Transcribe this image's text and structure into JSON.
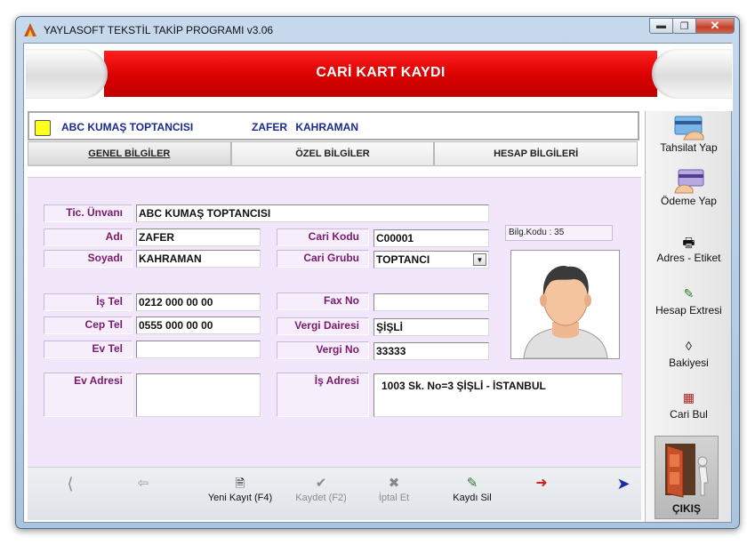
{
  "window": {
    "title": "YAYLASOFT TEKSTİL TAKİP PROGRAMI v3.06",
    "minimize_icon": "minimize-icon",
    "restore_icon": "restore-icon",
    "close_icon": "close-icon"
  },
  "banner": {
    "title": "CARİ KART KAYDI"
  },
  "info": {
    "company": "ABC KUMAŞ TOPTANCISI",
    "person": "ZAFER KAHRAMAN",
    "status_color": "#ffff20"
  },
  "tabs": [
    {
      "label": "GENEL BİLGİLER",
      "active": true
    },
    {
      "label": "ÖZEL BİLGİLER",
      "active": false
    },
    {
      "label": "HESAP BİLGİLERİ",
      "active": false
    }
  ],
  "form": {
    "tic_unvani": {
      "label": "Tic. Ünvanı",
      "value": "ABC KUMAŞ TOPTANCISI"
    },
    "adi": {
      "label": "Adı",
      "value": "ZAFER"
    },
    "soyadi": {
      "label": "Soyadı",
      "value": "KAHRAMAN"
    },
    "cari_kodu": {
      "label": "Cari Kodu",
      "value": "C00001"
    },
    "cari_grubu": {
      "label": "Cari Grubu",
      "value": "TOPTANCI"
    },
    "is_tel": {
      "label": "İş Tel",
      "value": "0212 000 00 00"
    },
    "cep_tel": {
      "label": "Cep Tel",
      "value": "0555 000 00 00"
    },
    "ev_tel": {
      "label": "Ev Tel",
      "value": ""
    },
    "fax_no": {
      "label": "Fax No",
      "value": ""
    },
    "vergi_dairesi": {
      "label": "Vergi Dairesi",
      "value": "ŞİŞLİ"
    },
    "vergi_no": {
      "label": "Vergi No",
      "value": "33333"
    },
    "ev_adresi": {
      "label": "Ev Adresi",
      "value": ""
    },
    "is_adresi": {
      "label": "İş Adresi",
      "value": "1003 Sk. No=3 ŞİŞLİ - İSTANBUL"
    },
    "bilg_kodu": "Bilg.Kodu : 35"
  },
  "bottom": {
    "first_icon": "first-record-icon",
    "prev_icon": "previous-record-icon",
    "new_label": "Yeni Kayıt (F4)",
    "save_label": "Kaydet (F2)",
    "cancel_label": "İptal Et",
    "delete_label": "Kaydı Sil",
    "next_icon": "next-record-icon",
    "last_icon": "last-record-icon"
  },
  "sidebar": {
    "tahsilat": "Tahsilat Yap",
    "odeme": "Ödeme Yap",
    "adres": "Adres - Etiket",
    "extre": "Hesap Extresi",
    "bakiye": "Bakiyesi",
    "bul": "Cari Bul",
    "cikis": "ÇIKIŞ"
  },
  "colors": {
    "banner_red": "#e00000",
    "form_bg": "#f2e7fa",
    "label_text": "#7a1a6e",
    "info_text": "#1a2a8f"
  }
}
